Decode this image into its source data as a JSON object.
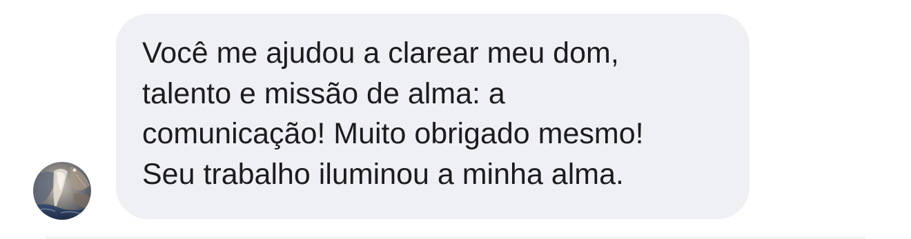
{
  "conversation": {
    "incoming_message": {
      "lines": [
        "Você me ajudou a clarear meu dom,",
        "talento e missão de alma: a",
        "comunicação! Muito obrigado mesmo!",
        "Seu trabalho iluminou a minha alma."
      ],
      "bubble_color": "#eff0f4",
      "text_color": "#1c1c1e"
    },
    "sender": {
      "avatar_icon": "profile-photo-avatar"
    }
  }
}
